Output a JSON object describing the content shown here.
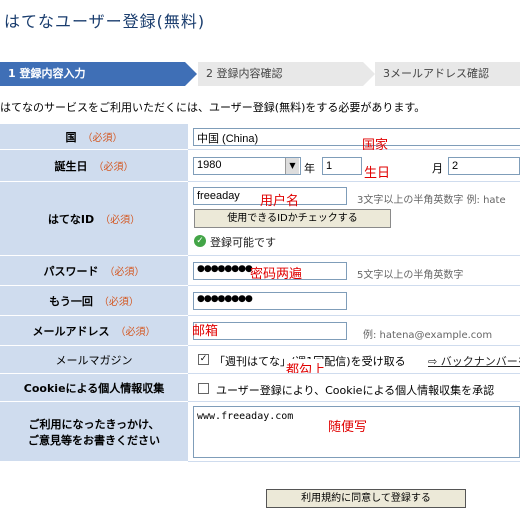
{
  "page_title": "はてなユーザー登録(無料)",
  "steps": [
    {
      "label": "1 登録内容入力"
    },
    {
      "label": "2 登録内容確認"
    },
    {
      "label": "3メールアドレス確認"
    }
  ],
  "intro": "はてなのサービスをご利用いただくには、ユーザー登録(無料)をする必要があります。",
  "required_label": "（必須）",
  "country": {
    "label": "国",
    "value": "中国 (China)",
    "annotation": "国家"
  },
  "birthday": {
    "label": "誕生日",
    "year": "1980",
    "year_unit": "年",
    "month_value": "1",
    "month_unit": "月",
    "day_value": "2",
    "annotation": "生日"
  },
  "hatena_id": {
    "label": "はてなID",
    "value": "freeaday",
    "annotation": "用户名",
    "hint": "3文字以上の半角英数字 例: hate",
    "check_button": "使用できるIDかチェックする",
    "status": "登録可能です"
  },
  "password": {
    "label": "パスワード",
    "value": "●●●●●●●●",
    "annotation": "密码两遍",
    "hint": "5文字以上の半角英数字"
  },
  "password_confirm": {
    "label": "もう一回",
    "value": "●●●●●●●●"
  },
  "email": {
    "label": "メールアドレス",
    "annotation": "邮箱",
    "hint": "例: hatena@example.com"
  },
  "magazine": {
    "label": "メールマガジン",
    "text": "「週刊はてな」(週1回配信)を受け取る",
    "backnumber": "バックナンバーを",
    "annotation": "都勾上"
  },
  "cookie": {
    "label": "Cookieによる個人情報収集",
    "text": "ユーザー登録により、Cookieによる個人情報収集を承認"
  },
  "comments": {
    "label_line1": "ご利用になったきっかけ、",
    "label_line2": "ご意見等をお書きください",
    "value": "www.freeaday.com",
    "annotation": "随便写"
  },
  "submit_button": "利用規約に同意して登録する",
  "colors": {
    "accent": "#3f6fb6",
    "label_bg": "#cfdcee",
    "required": "#d4561f",
    "annotation": "#e00000"
  }
}
